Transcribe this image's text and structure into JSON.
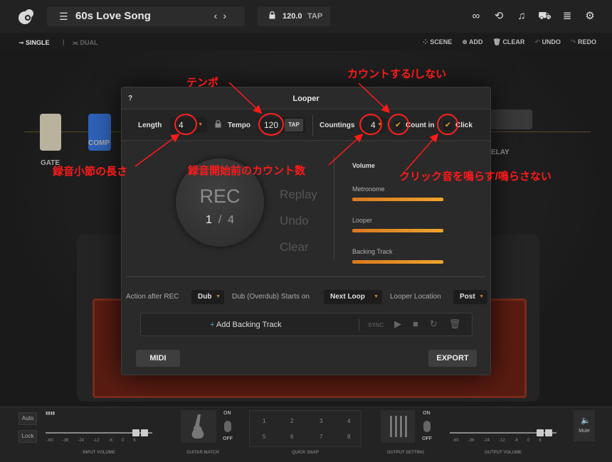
{
  "topbar": {
    "preset_name": "60s Love Song",
    "tempo": "120.0",
    "tap": "TAP"
  },
  "toolbar": {
    "single": "SINGLE",
    "dual": "DUAL",
    "scene": "SCENE",
    "add": "ADD",
    "clear": "CLEAR",
    "undo": "UNDO",
    "redo": "REDO"
  },
  "stage": {
    "gate": "GATE",
    "comp": "COMP",
    "delay": "ELAY"
  },
  "looper": {
    "title": "Looper",
    "help": "?",
    "length_label": "Length",
    "length_value": "4",
    "tempo_label": "Tempo",
    "tempo_value": "120",
    "tap_label": "TAP",
    "countings_label": "Countings",
    "countings_value": "4",
    "count_in_label": "Count in",
    "click_label": "Click",
    "rec_label": "REC",
    "rec_current": "1",
    "rec_sep": "/",
    "rec_total": "4",
    "replay": "Replay",
    "undo": "Undo",
    "clear": "Clear",
    "volume_title": "Volume",
    "volumes": [
      {
        "label": "Metronome",
        "level": 1.0
      },
      {
        "label": "Looper",
        "level": 1.0
      },
      {
        "label": "Backing Track",
        "level": 1.0
      }
    ],
    "action_after_rec_label": "Action after REC",
    "action_after_rec_value": "Dub",
    "dub_starts_label": "Dub (Overdub) Starts on",
    "dub_starts_value": "Next Loop",
    "looper_location_label": "Looper Location",
    "looper_location_value": "Post",
    "add_backing_track": "Add Backing Track",
    "sync": "SYNC",
    "midi": "MIDI",
    "export": "EXPORT"
  },
  "bottom": {
    "auto": "Auto",
    "lock": "Lock",
    "scale_left": [
      "-60",
      "-36",
      "-24",
      "-12",
      "-6",
      "0",
      "6"
    ],
    "input_volume": "INPUT VOLUME",
    "guitar_match": "GUITAR MATCH",
    "on": "ON",
    "off": "OFF",
    "quick_snap": "QUICK SNAP",
    "qs_numbers": [
      "1",
      "2",
      "3",
      "4",
      "5",
      "6",
      "7",
      "8"
    ],
    "output_setting": "OUTPUT SETTING",
    "output_volume": "OUTPUT VOLUME",
    "mute": "Mute"
  },
  "annotations": {
    "tempo": "テンポ",
    "count_toggle": "カウントする/しない",
    "length": "録音小節の長さ",
    "count_num": "録音開始前のカウント数",
    "click_toggle": "クリック音を鳴らす/鳴らさない"
  },
  "colors": {
    "accent": "#e09a2a",
    "annotation": "#ff1a1a",
    "link": "#4aa6d8"
  }
}
